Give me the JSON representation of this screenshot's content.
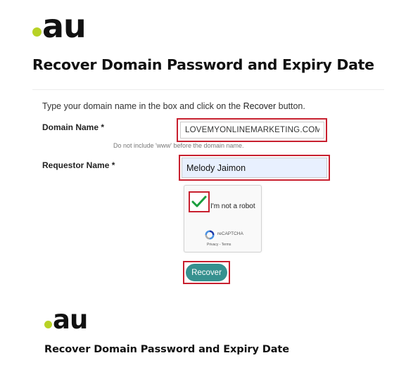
{
  "brand": {
    "logo_text": "au",
    "accent_color": "#b8d226",
    "title": "Recover Domain Password and Expiry Date"
  },
  "form": {
    "instruction_prefix": "Type your domain name in the box and click on the ",
    "instruction_emphasis": "Recover",
    "instruction_suffix": " button.",
    "domain_label": "Domain Name *",
    "domain_value": "LOVEMYONLINEMARKETING.COM.AU",
    "domain_hint": "Do not include 'www' before the domain name.",
    "requestor_label": "Requestor Name *",
    "requestor_value": "Melody Jaimon",
    "recover_label": "Recover",
    "highlight_color": "#c8202f",
    "button_color": "#36918f"
  },
  "captcha": {
    "label": "I'm not a robot",
    "brand": "reCAPTCHA",
    "links": "Privacy - Terms",
    "checked": true,
    "check_color": "#1a9e3e"
  },
  "icons": {
    "check": "checkmark-icon",
    "recaptcha": "recaptcha-logo-icon"
  }
}
